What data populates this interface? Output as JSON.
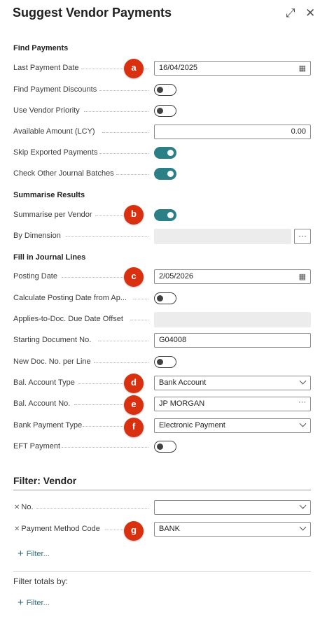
{
  "header": {
    "title": "Suggest Vendor Payments",
    "expand_glyph": "⤢",
    "close_glyph": "✕"
  },
  "sections": {
    "find_payments": "Find Payments",
    "summarise_results": "Summarise Results",
    "fill_in_journal_lines": "Fill in Journal Lines"
  },
  "fields": {
    "last_payment_date": {
      "label": "Last Payment Date",
      "value": "16/04/2025"
    },
    "find_payment_discounts": {
      "label": "Find Payment Discounts",
      "checked": false
    },
    "use_vendor_priority": {
      "label": "Use Vendor Priority",
      "checked": false
    },
    "available_amount": {
      "label": "Available Amount (LCY)",
      "value": "0.00"
    },
    "skip_exported_payments": {
      "label": "Skip Exported Payments",
      "checked": true
    },
    "check_other_journal_batches": {
      "label": "Check Other Journal Batches",
      "checked": true
    },
    "summarise_per_vendor": {
      "label": "Summarise per Vendor",
      "checked": true
    },
    "by_dimension": {
      "label": "By Dimension",
      "value": "",
      "button": "···"
    },
    "posting_date": {
      "label": "Posting Date",
      "value": "2/05/2026"
    },
    "calc_posting_date": {
      "label": "Calculate Posting Date from Ap...",
      "checked": false
    },
    "applies_to_doc_offset": {
      "label": "Applies-to-Doc. Due Date Offset",
      "value": ""
    },
    "starting_document_no": {
      "label": "Starting Document No.",
      "value": "G04008"
    },
    "new_doc_no_per_line": {
      "label": "New Doc. No. per Line",
      "checked": false
    },
    "bal_account_type": {
      "label": "Bal. Account Type",
      "value": "Bank Account"
    },
    "bal_account_no": {
      "label": "Bal. Account No.",
      "value": "JP MORGAN",
      "button": "···"
    },
    "bank_payment_type": {
      "label": "Bank Payment Type",
      "value": "Electronic Payment"
    },
    "eft_payment": {
      "label": "EFT Payment",
      "checked": false
    }
  },
  "filter_vendor": {
    "title": "Filter: Vendor",
    "remove_glyph": "✕",
    "no": {
      "label": "No.",
      "value": ""
    },
    "payment_method_code": {
      "label": "Payment Method Code",
      "value": "BANK"
    },
    "add_filter": "Filter...",
    "plus_glyph": "+"
  },
  "filter_totals": {
    "label": "Filter totals by:",
    "add_filter": "Filter...",
    "plus_glyph": "+"
  },
  "calendar_glyph": "▦",
  "badges": [
    "a",
    "b",
    "c",
    "d",
    "e",
    "f",
    "g"
  ],
  "colors": {
    "toggle_on": "#2b7f87",
    "badge": "#d9310f",
    "link": "#2b6c74"
  }
}
